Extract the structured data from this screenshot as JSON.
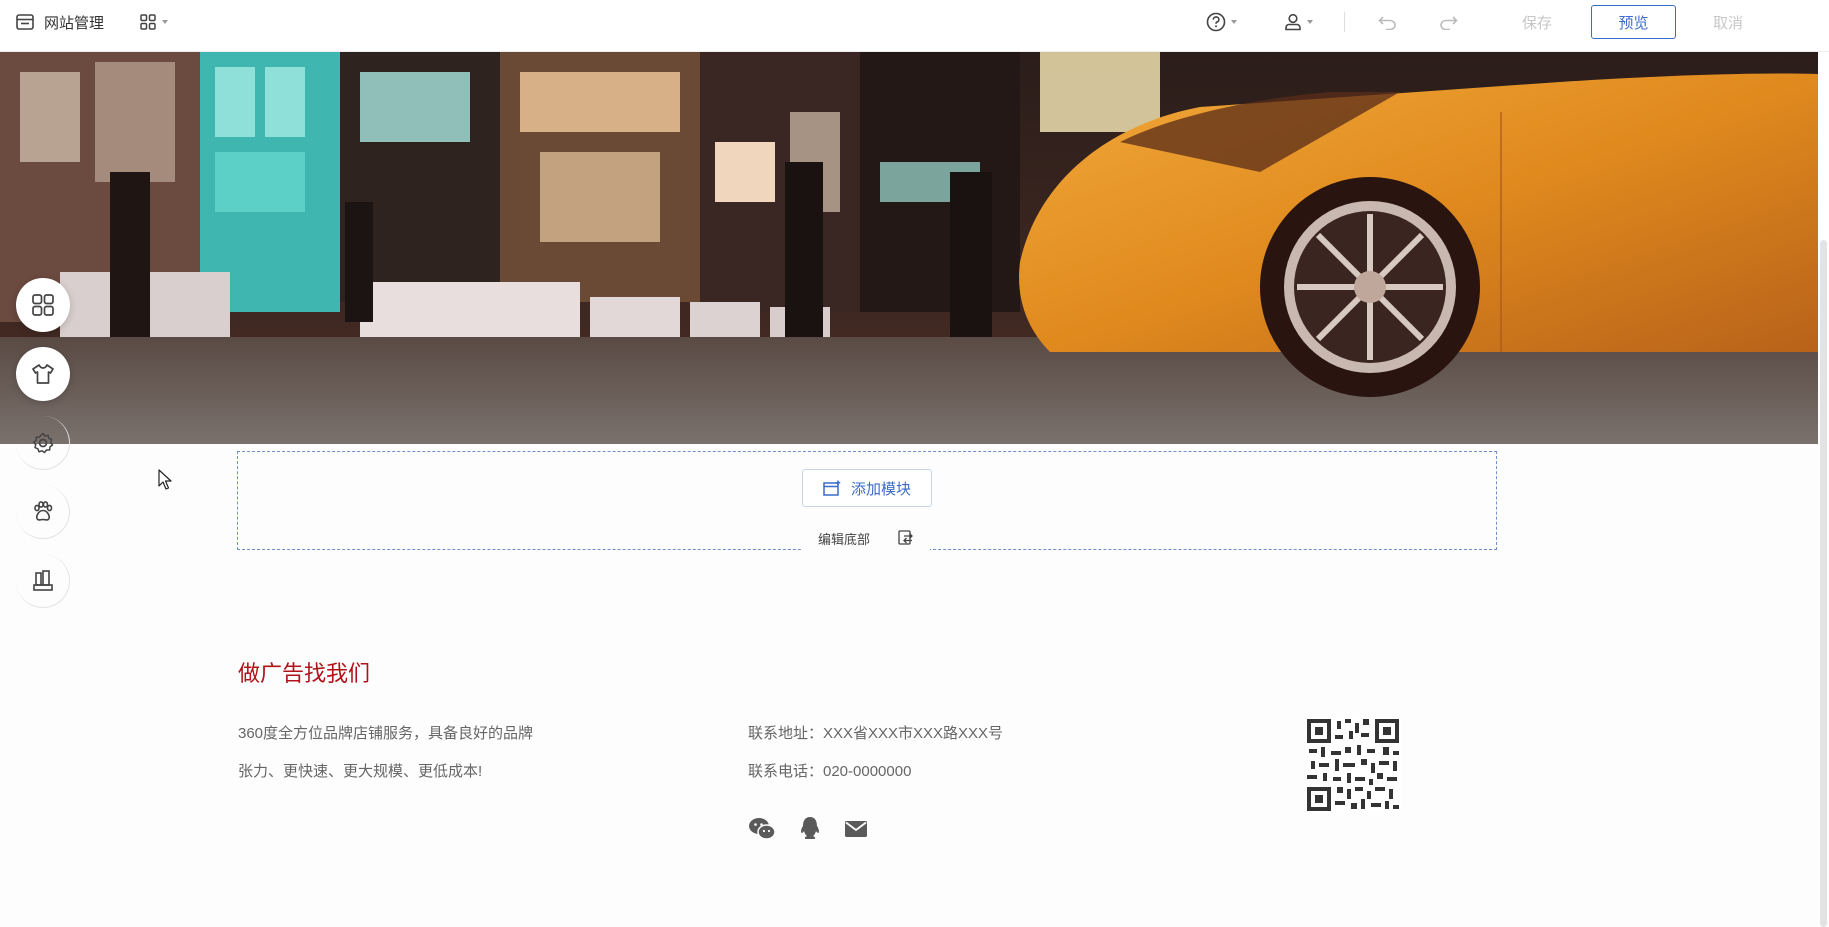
{
  "topbar": {
    "site_management": "网站管理",
    "save": "保存",
    "preview": "预览",
    "cancel": "取消",
    "icons": [
      "site-admin-icon",
      "apps-grid-icon",
      "help-icon",
      "user-icon",
      "undo-icon",
      "redo-icon"
    ]
  },
  "dock": {
    "items": [
      "apps-grid-icon",
      "shirt-icon",
      "gear-icon",
      "paw-icon",
      "building-icon"
    ]
  },
  "editor": {
    "add_module": "添加模块",
    "edit_footer": "编辑底部"
  },
  "footer": {
    "title": "做广告找我们",
    "desc_line1": "360度全方位品牌店铺服务，具备良好的品牌",
    "desc_line2": "张力、更快速、更大规模、更低成本!",
    "address": "联系地址：XXX省XXX市XXX路XXX号",
    "phone": "联系电话：020-0000000",
    "social_icons": [
      "wechat-icon",
      "qq-icon",
      "mail-icon"
    ]
  },
  "colors": {
    "accent_blue": "#3b6cc7",
    "title_red": "#b0141a",
    "taxi_orange": "#e08a1e"
  }
}
